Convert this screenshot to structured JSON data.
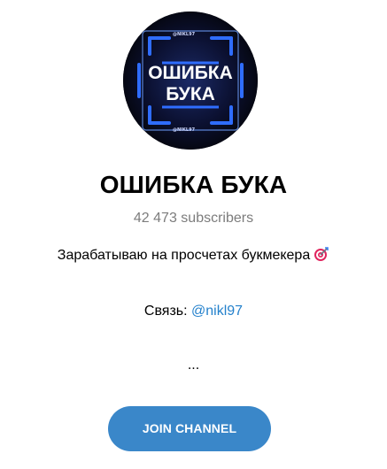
{
  "channel": {
    "avatar_text_line1": "ОШИБКА",
    "avatar_text_line2": "БУКА",
    "avatar_frame_text": "@NIKL97",
    "title": "ОШИБКА БУКА",
    "subscribers": "42 473 subscribers",
    "description": "Зарабатываю на просчетах букмекера",
    "description_icon": "target-icon",
    "contact_label": "Связь: ",
    "contact_link": "@nikl97",
    "ellipsis": "...",
    "join_label": "JOIN CHANNEL"
  },
  "colors": {
    "accent": "#3a87c9",
    "link": "#2481cc",
    "muted": "#7c7c7c",
    "neon": "#2a6bff"
  }
}
